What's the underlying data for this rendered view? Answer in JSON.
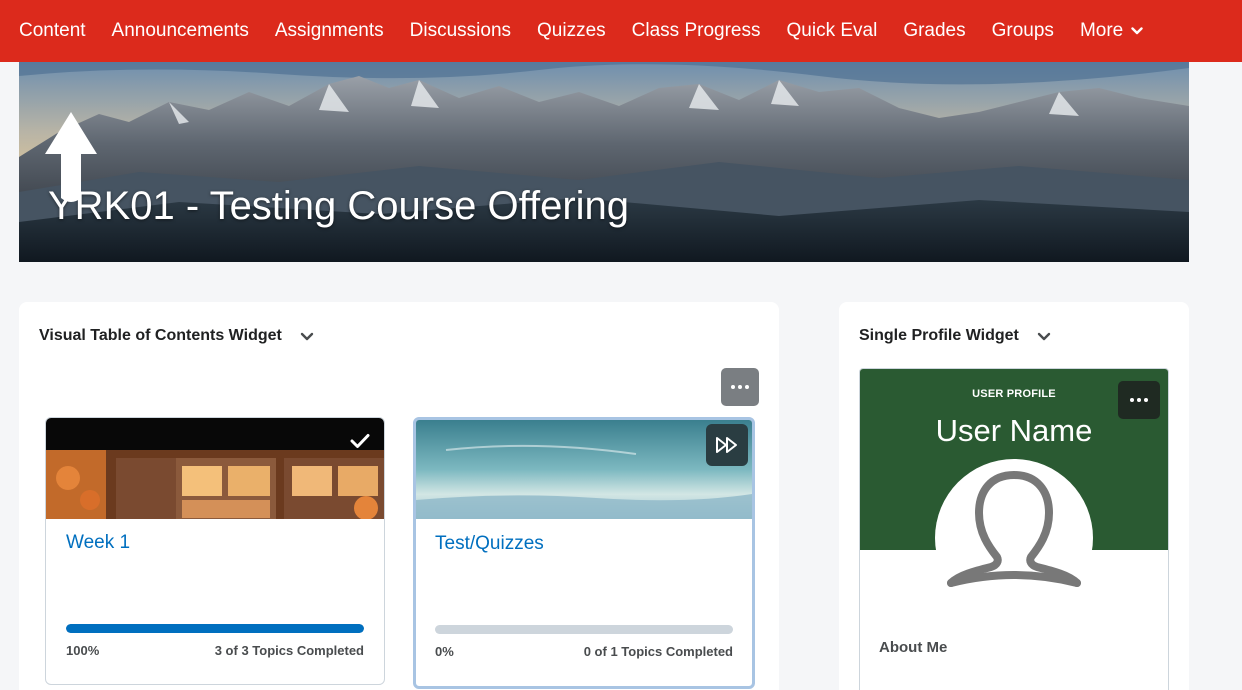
{
  "nav": {
    "items": [
      {
        "label": "Content"
      },
      {
        "label": "Announcements"
      },
      {
        "label": "Assignments"
      },
      {
        "label": "Discussions"
      },
      {
        "label": "Quizzes"
      },
      {
        "label": "Class Progress"
      },
      {
        "label": "Quick Eval"
      },
      {
        "label": "Grades"
      },
      {
        "label": "Groups"
      }
    ],
    "more_label": "More",
    "more_icon": "chevron-down-icon",
    "colors": {
      "bar": "#dc2a1c",
      "text": "#ffffff"
    }
  },
  "banner": {
    "course_title": "YRK01 - Testing Course Offering",
    "annotation_icon": "up-arrow-icon"
  },
  "vtoc_widget": {
    "title": "Visual Table of Contents Widget",
    "menu_icon": "more-options-icon",
    "cards": [
      {
        "title": "Week 1",
        "progress": 1.0,
        "percent_label": "100%",
        "topics_label": "3 of 3 Topics Completed",
        "status_icon": "checkmark-icon"
      },
      {
        "title": "Test/Quizzes",
        "progress": 0.0,
        "percent_label": "0%",
        "topics_label": "0 of 1 Topics Completed",
        "status_icon": "skip-forward-icon"
      }
    ],
    "colors": {
      "link": "#006fbf",
      "progress_fill": "#006fbf",
      "progress_track": "#cdd5dc"
    }
  },
  "profile_widget": {
    "title": "Single Profile Widget",
    "caption": "USER PROFILE",
    "user_name": "User Name",
    "about_label": "About Me",
    "avatar_icon": "user-silhouette-icon",
    "colors": {
      "header": "#2a5a32"
    }
  }
}
